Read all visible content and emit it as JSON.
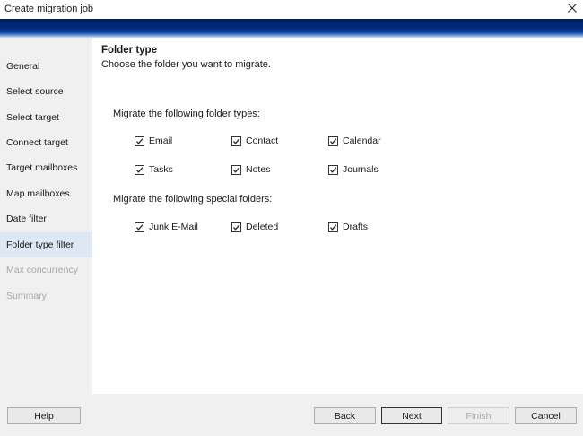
{
  "window": {
    "title": "Create migration job",
    "close_icon": "close-icon"
  },
  "sidebar": {
    "items": [
      {
        "label": "General",
        "state": "normal"
      },
      {
        "label": "Select source",
        "state": "normal"
      },
      {
        "label": "Select target",
        "state": "normal"
      },
      {
        "label": "Connect target",
        "state": "normal"
      },
      {
        "label": "Target mailboxes",
        "state": "normal"
      },
      {
        "label": "Map mailboxes",
        "state": "normal"
      },
      {
        "label": "Date filter",
        "state": "normal"
      },
      {
        "label": "Folder type filter",
        "state": "active"
      },
      {
        "label": "Max concurrency",
        "state": "disabled"
      },
      {
        "label": "Summary",
        "state": "disabled"
      }
    ]
  },
  "main": {
    "title": "Folder type",
    "subtitle": "Choose the folder you want to migrate.",
    "folder_types": {
      "label": "Migrate the following folder types:",
      "options": [
        {
          "label": "Email",
          "checked": true
        },
        {
          "label": "Contact",
          "checked": true
        },
        {
          "label": "Calendar",
          "checked": true
        },
        {
          "label": "Tasks",
          "checked": true
        },
        {
          "label": "Notes",
          "checked": true
        },
        {
          "label": "Journals",
          "checked": true
        }
      ]
    },
    "special_folders": {
      "label": "Migrate the following special folders:",
      "options": [
        {
          "label": "Junk E-Mail",
          "checked": true
        },
        {
          "label": "Deleted",
          "checked": true
        },
        {
          "label": "Drafts",
          "checked": true
        }
      ]
    }
  },
  "footer": {
    "help": "Help",
    "back": "Back",
    "next": "Next",
    "finish": "Finish",
    "cancel": "Cancel"
  },
  "colors": {
    "banner": "#002a78",
    "active_item": "#dde8f4",
    "disabled_text": "#a8a8a8"
  }
}
